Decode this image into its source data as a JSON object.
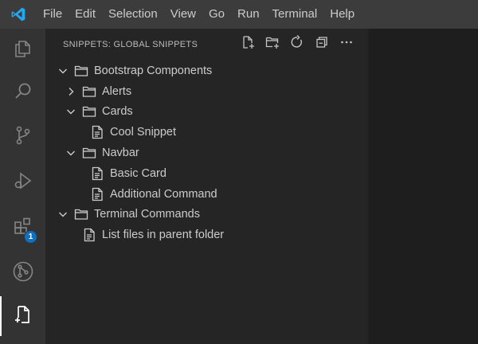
{
  "menu": [
    "File",
    "Edit",
    "Selection",
    "View",
    "Go",
    "Run",
    "Terminal",
    "Help"
  ],
  "activity": {
    "items": [
      {
        "icon": "explorer-icon"
      },
      {
        "icon": "search-icon"
      },
      {
        "icon": "source-control-icon"
      },
      {
        "icon": "run-debug-icon"
      },
      {
        "icon": "extensions-icon",
        "badge": "1"
      },
      {
        "icon": "gitlens-icon"
      },
      {
        "icon": "snippets-icon",
        "active": true
      }
    ]
  },
  "sidebar": {
    "title": "SNIPPETS: GLOBAL SNIPPETS",
    "actions": [
      "new-snippet-icon",
      "new-folder-icon",
      "refresh-icon",
      "collapse-all-icon",
      "more-actions-icon"
    ]
  },
  "tree": [
    {
      "label": "Bootstrap Components",
      "kind": "folder",
      "level": 0,
      "state": "expanded"
    },
    {
      "label": "Alerts",
      "kind": "folder",
      "level": 1,
      "state": "collapsed"
    },
    {
      "label": "Cards",
      "kind": "folder",
      "level": 1,
      "state": "expanded"
    },
    {
      "label": "Cool Snippet",
      "kind": "file",
      "level": 2
    },
    {
      "label": "Navbar",
      "kind": "folder",
      "level": 1,
      "state": "expanded"
    },
    {
      "label": "Basic Card",
      "kind": "file",
      "level": 2
    },
    {
      "label": "Additional Command",
      "kind": "file",
      "level": 2
    },
    {
      "label": "Terminal Commands",
      "kind": "folder",
      "level": 0,
      "state": "expanded"
    },
    {
      "label": "List files in parent folder",
      "kind": "file",
      "level": 1
    }
  ],
  "colors": {
    "accent": "#0e70c0",
    "logo": "#23a9f2"
  }
}
